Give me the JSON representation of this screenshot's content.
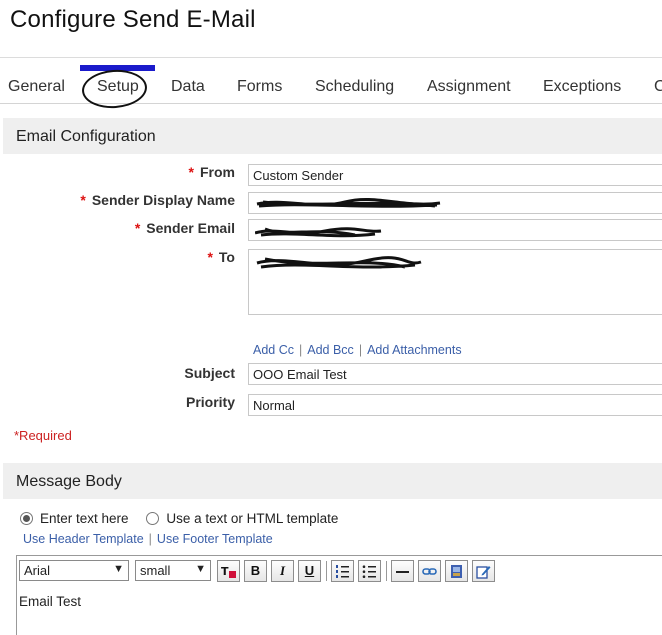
{
  "page": {
    "title": "Configure Send E-Mail"
  },
  "tabs": [
    "General",
    "Setup",
    "Data",
    "Forms",
    "Scheduling",
    "Assignment",
    "Exceptions",
    "C"
  ],
  "active_tab": "Setup",
  "email_config": {
    "header": "Email Configuration",
    "from_label": "From",
    "from_value": "Custom Sender",
    "sender_display_name_label": "Sender Display Name",
    "sender_email_label": "Sender Email",
    "to_label": "To",
    "links": {
      "add_cc": "Add Cc",
      "add_bcc": "Add Bcc",
      "add_attachments": "Add Attachments",
      "separator": "|"
    },
    "subject_label": "Subject",
    "subject_value": "OOO Email Test",
    "priority_label": "Priority",
    "priority_value": "Normal",
    "required_note": "*Required",
    "required_marker": "*"
  },
  "message_body": {
    "header": "Message Body",
    "option_enter_text": "Enter text here",
    "option_template": "Use a text or HTML template",
    "use_header_template": "Use Header Template",
    "use_footer_template": "Use Footer Template",
    "separator": "|",
    "font_family": "Arial",
    "font_size": "small",
    "body_text": "Email Test",
    "toolbar": {
      "bold": "B",
      "italic": "I",
      "underline": "U"
    }
  },
  "colors": {
    "tab_accent": "#1a1acb",
    "required": "#cc2222",
    "link": "#3b5fa8",
    "header_bg": "#efefef"
  }
}
